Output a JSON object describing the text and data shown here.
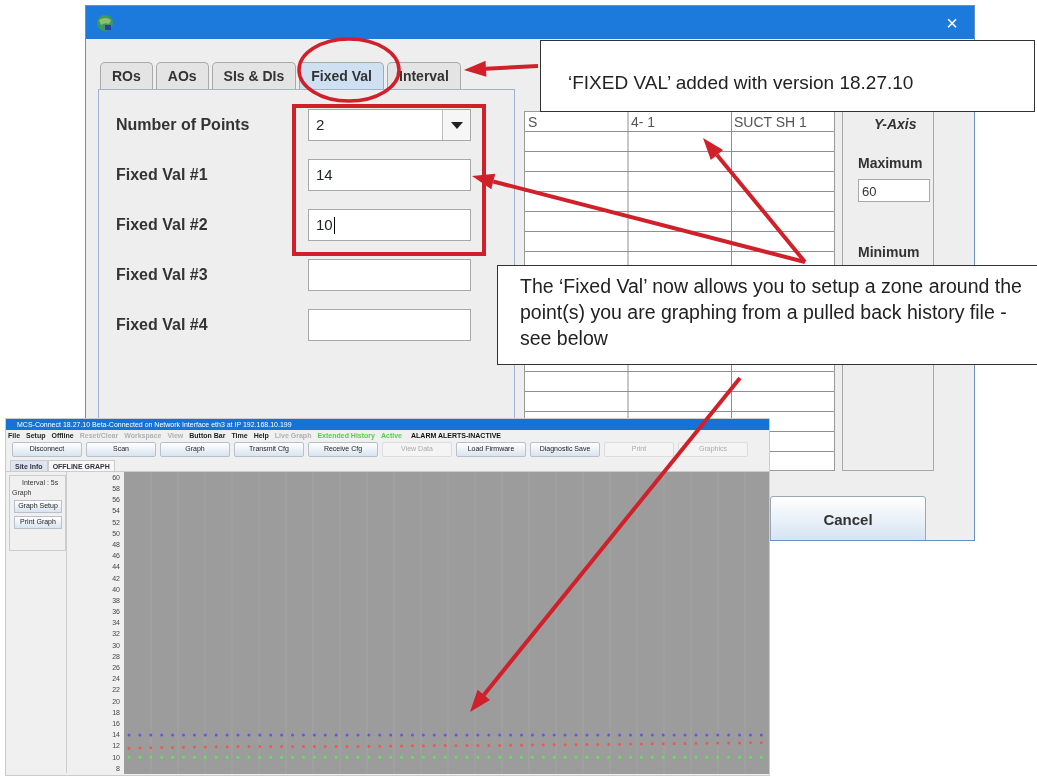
{
  "dialog": {
    "close": "×",
    "tabs": [
      {
        "label": "ROs",
        "selected": false
      },
      {
        "label": "AOs",
        "selected": false
      },
      {
        "label": "SIs & DIs",
        "selected": false
      },
      {
        "label": "Fixed Val",
        "selected": true
      },
      {
        "label": "Interval",
        "selected": false
      }
    ],
    "form": [
      {
        "kind": "select",
        "label": "Number of Points",
        "value": "2",
        "focused": false
      },
      {
        "kind": "input",
        "label": "Fixed Val #1",
        "value": "14",
        "focused": false
      },
      {
        "kind": "input",
        "label": "Fixed Val #2",
        "value": "10",
        "focused": true
      },
      {
        "kind": "input",
        "label": "Fixed Val #3",
        "focused": false
      },
      {
        "kind": "input",
        "label": "Fixed Val #4",
        "focused": false
      }
    ],
    "table": {
      "columns": [
        "S",
        "4- 1",
        "SUCT SH 1"
      ]
    },
    "y_axis": {
      "title": "Y-Axis",
      "maximum_label": "Maximum",
      "maximum_value": "60",
      "minimum_label": "Minimum"
    },
    "cancel": "Cancel"
  },
  "callouts": [
    {
      "text": "‘FIXED VAL’  added with version 18.27.10"
    },
    {
      "text": "The ‘Fixed Val’ now allows you to setup a zone around the point(s) you are graphing from a pulled back history file - see below"
    }
  ],
  "app": {
    "title": "MCS-Connect 18.27.10 Beta-Connected on Network Interface eth3 at IP 192.168.10.199",
    "menu": [
      {
        "label": "File",
        "kind": "menu",
        "disabled": false
      },
      {
        "label": "Setup",
        "kind": "menu",
        "disabled": false
      },
      {
        "label": "Offline",
        "kind": "menu",
        "disabled": false
      },
      {
        "label": "Reset/Clear",
        "kind": "menu",
        "disabled": true
      },
      {
        "label": "Workspace",
        "kind": "menu",
        "disabled": true
      },
      {
        "label": "View",
        "kind": "menu",
        "disabled": true
      },
      {
        "label": "Button Bar",
        "kind": "menu",
        "disabled": false
      },
      {
        "label": "Time",
        "kind": "menu",
        "disabled": false
      },
      {
        "label": "Help",
        "kind": "menu",
        "disabled": false
      },
      {
        "label": "Live Graph",
        "kind": "menu",
        "disabled": true
      },
      {
        "label": "Extended History",
        "kind": "status"
      },
      {
        "label": "Active",
        "kind": "status"
      },
      {
        "label": "ALARM ALERTS-INACTIVE",
        "kind": "alert"
      }
    ],
    "toolbar": [
      {
        "label": "Disconnect",
        "disabled": false
      },
      {
        "label": "Scan",
        "disabled": false
      },
      {
        "label": "Graph",
        "disabled": false
      },
      {
        "label": "Transmit Cfg",
        "disabled": false
      },
      {
        "label": "Receive Cfg",
        "disabled": false
      },
      {
        "label": "View Data",
        "disabled": true
      },
      {
        "label": "Load Firmware",
        "disabled": false
      },
      {
        "label": "Diagnostic Save",
        "disabled": false
      },
      {
        "label": "Print",
        "disabled": true
      },
      {
        "label": "Graphics",
        "disabled": true
      }
    ],
    "tabs": [
      {
        "label": "Site Info",
        "selected": false
      },
      {
        "label": "OFFLINE GRAPH",
        "selected": true
      }
    ],
    "side": {
      "interval": "Interval : 5s",
      "group": "Graph",
      "buttons": [
        "Graph Setup",
        "Print Graph"
      ]
    },
    "chart_data": {
      "type": "line",
      "ylim": [
        7,
        61
      ],
      "yticks": [
        60,
        58,
        56,
        54,
        52,
        50,
        48,
        46,
        44,
        42,
        40,
        38,
        36,
        34,
        32,
        30,
        28,
        26,
        24,
        22,
        20,
        18,
        16,
        14,
        12,
        10,
        8
      ],
      "series": [
        {
          "color": "#5a5ae6",
          "line_style": "dotted",
          "values": [
            14,
            14,
            14,
            14,
            14,
            14,
            14,
            14,
            14,
            14,
            14,
            14,
            14
          ]
        },
        {
          "color": "#ee5a4a",
          "line_style": "dotted",
          "values": [
            11.6,
            11.8,
            11.9,
            11.9,
            11.9,
            12.0,
            12.1,
            12.1,
            12.2,
            12.3,
            12.4,
            12.5,
            12.6
          ]
        },
        {
          "color": "#5ee65a",
          "line_style": "dotted",
          "values": [
            10,
            10,
            10,
            10,
            10,
            10,
            10,
            10,
            10,
            10,
            10,
            10,
            10
          ]
        }
      ]
    }
  }
}
